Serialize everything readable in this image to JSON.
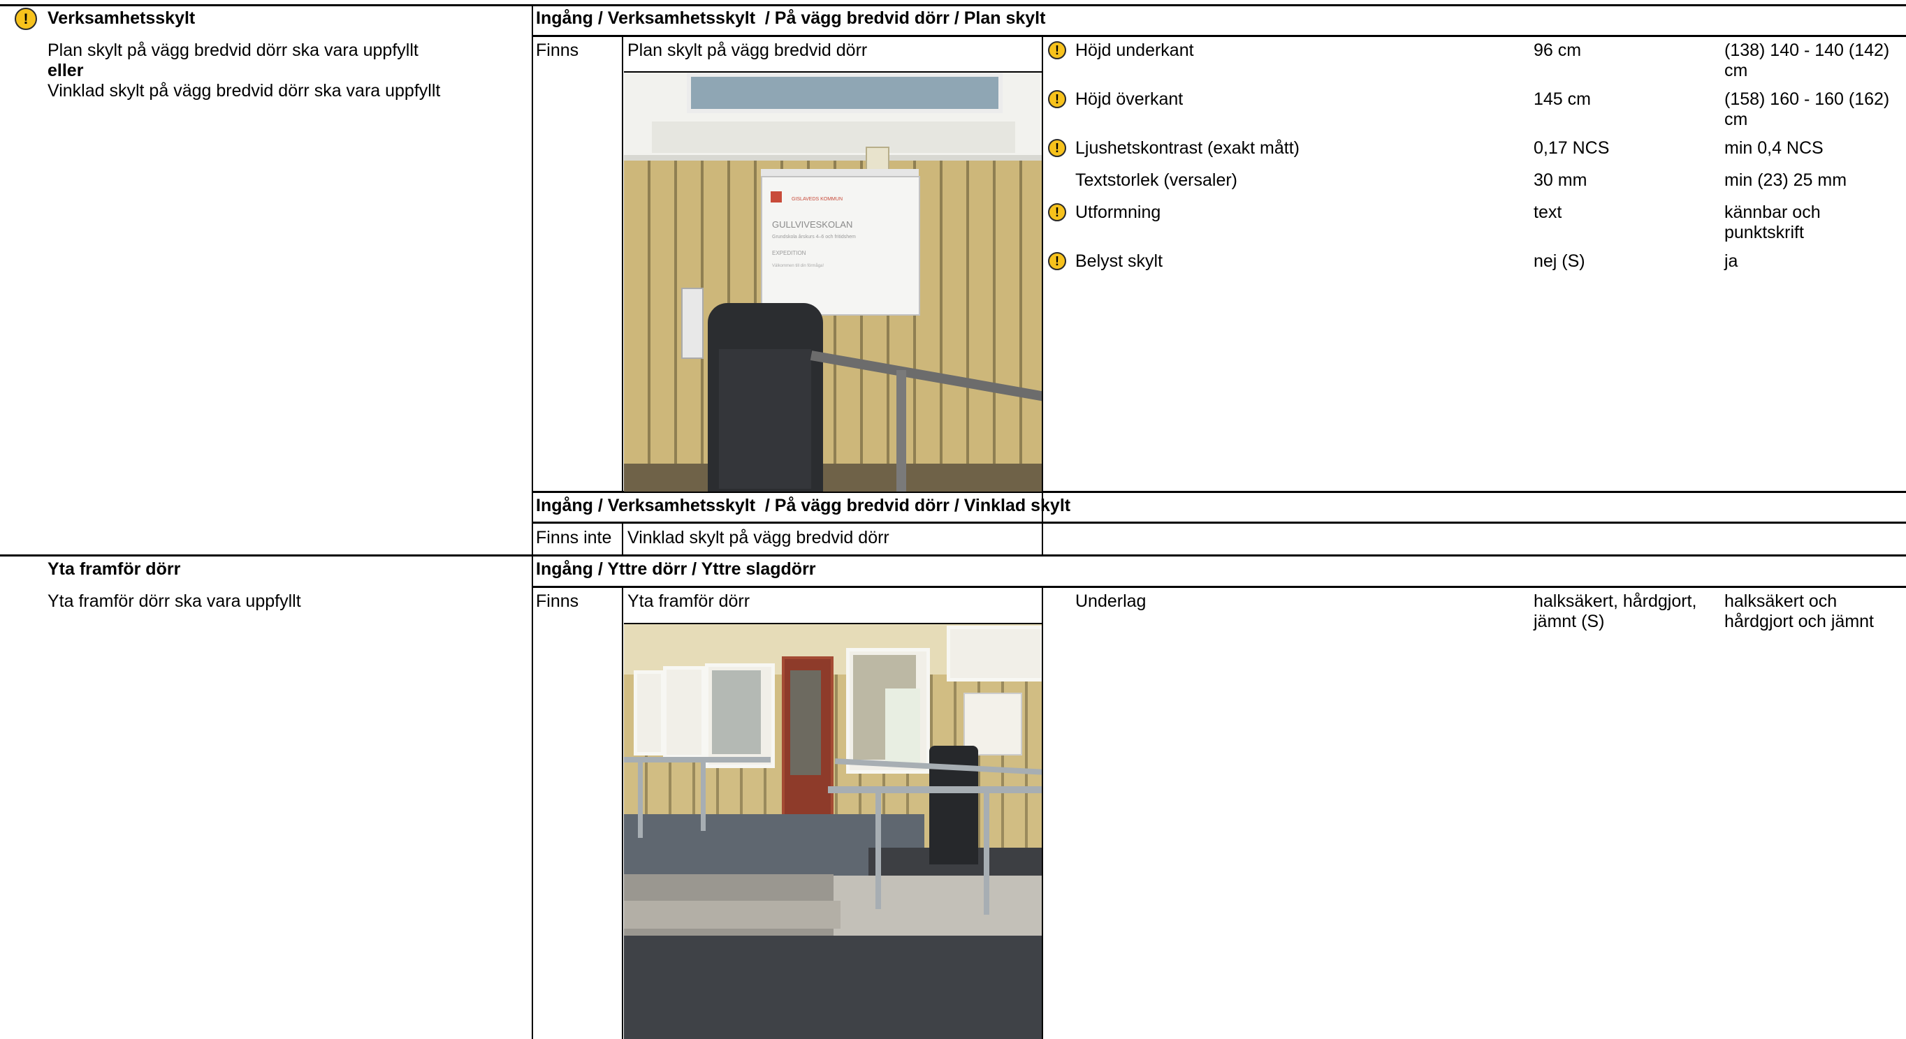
{
  "left_column": {
    "section1": {
      "title": "Verksamhetsskylt",
      "line1": "Plan skylt på vägg bredvid dörr ska vara uppfyllt",
      "connector": "eller",
      "line2": "Vinklad skylt på vägg bredvid dörr ska vara uppfyllt"
    },
    "section2": {
      "title": "Yta framför dörr",
      "line1": "Yta framför dörr ska vara uppfyllt"
    }
  },
  "blocks": {
    "plan": {
      "header": "Ingång / Verksamhetsskylt  / På vägg bredvid dörr / Plan skylt",
      "status": "Finns",
      "item": "Plan skylt på vägg bredvid dörr",
      "measurements": [
        {
          "name": "Höjd underkant",
          "value": "96 cm",
          "req1": "(138) 140 - 140 (142)",
          "req2": "cm",
          "warn": true
        },
        {
          "name": "Höjd överkant",
          "value": "145 cm",
          "req1": "(158) 160 - 160 (162)",
          "req2": "cm",
          "warn": true
        },
        {
          "name": "Ljushetskontrast (exakt mått)",
          "value": "0,17 NCS",
          "req1": "min 0,4 NCS",
          "warn": true
        },
        {
          "name": "Textstorlek (versaler)",
          "value": "30 mm",
          "req1": "min (23) 25 mm",
          "warn": false
        },
        {
          "name": "Utformning",
          "value": "text",
          "req1": "kännbar och",
          "req2": "punktskrift",
          "warn": true
        },
        {
          "name": "Belyst skylt",
          "value": "nej (S)",
          "req1": "ja",
          "warn": true
        }
      ]
    },
    "vinklad": {
      "header": "Ingång / Verksamhetsskylt  / På vägg bredvid dörr / Vinklad skylt",
      "status": "Finns inte",
      "item": "Vinklad skylt på vägg bredvid dörr"
    },
    "yta": {
      "header": "Ingång / Yttre dörr / Yttre slagdörr",
      "status": "Finns",
      "item": "Yta framför dörr",
      "measurements": [
        {
          "name": "Underlag",
          "value1": "halksäkert, hårdgjort,",
          "value2": "jämnt (S)",
          "req1": "halksäkert och",
          "req2": "hårdgjort och jämnt"
        }
      ]
    }
  },
  "icons": {
    "warning": "exclamation-warning-icon",
    "warning_glyph": "!",
    "warning_color": "#f7c21c"
  },
  "photos": {
    "sign_text": {
      "brand": "GISLAVEDS KOMMUN",
      "school": "GULLVIVESKOLAN",
      "line1": "Grundskola årskurs 4–6 och fritidshem",
      "line2": "EXPEDITION",
      "line3": "Välkommen till din förmåga!"
    }
  }
}
